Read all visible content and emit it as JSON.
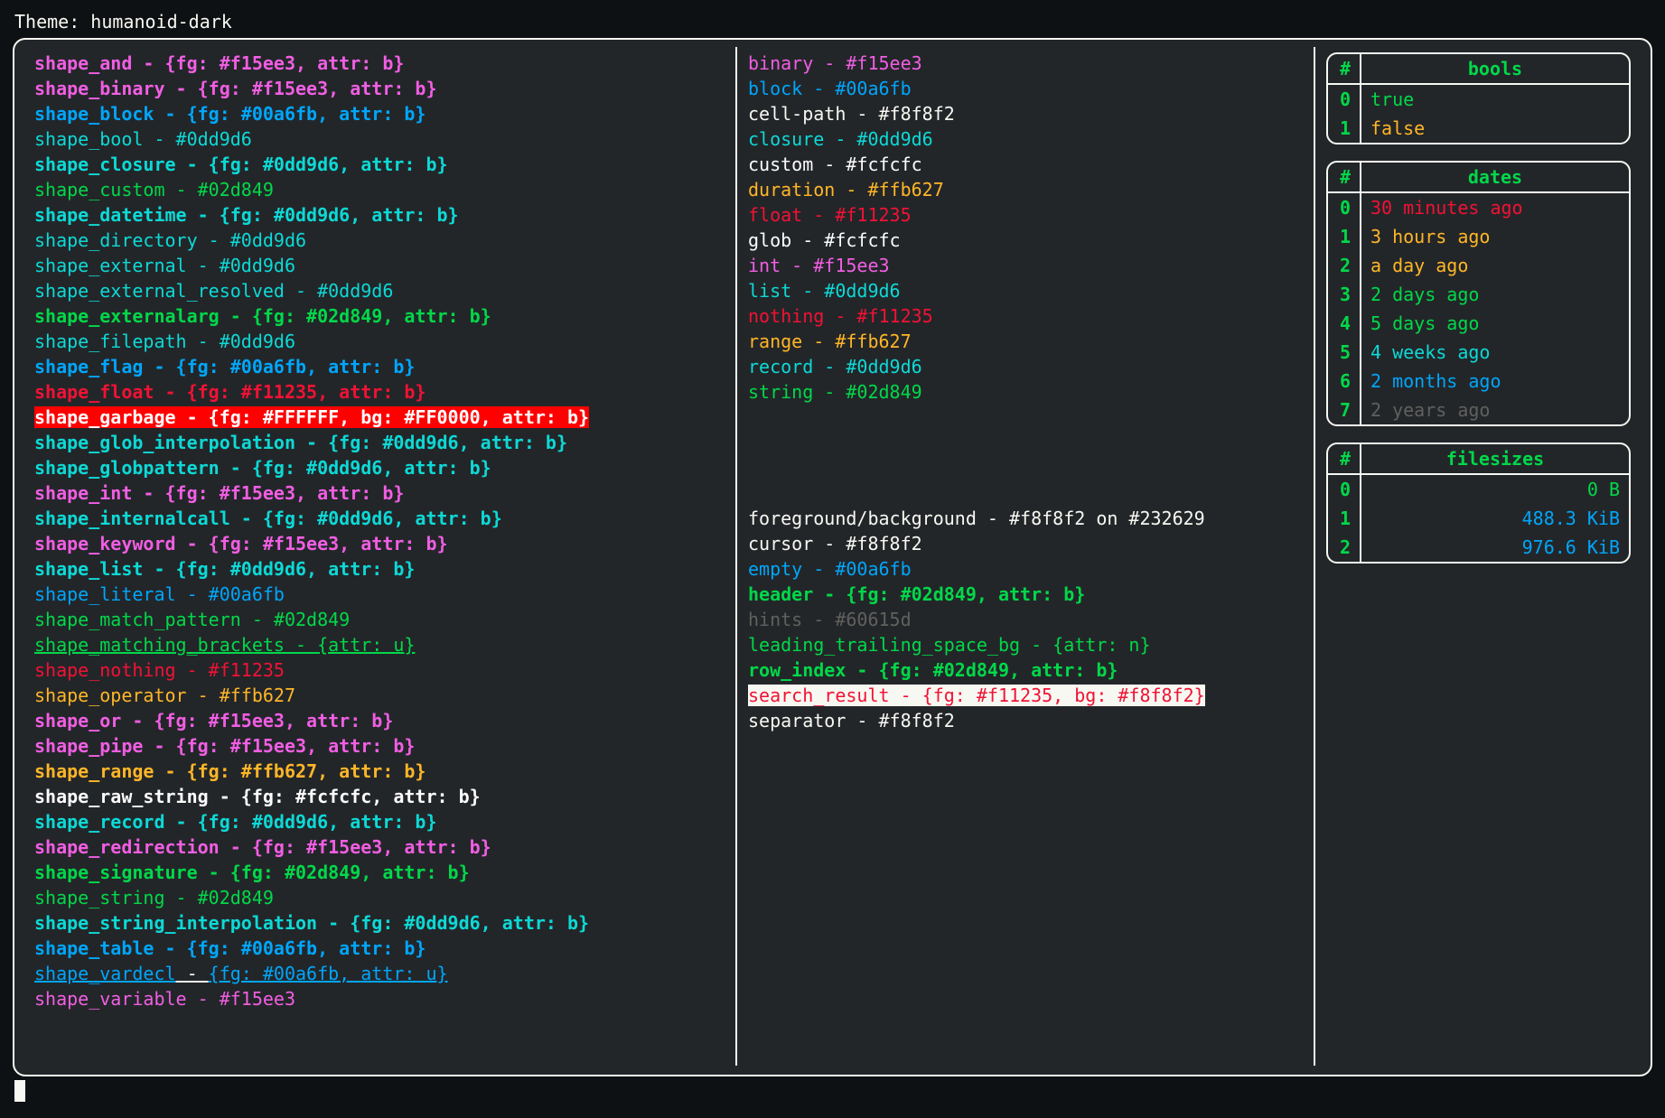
{
  "title": "Theme: humanoid-dark",
  "palette": {
    "magenta": "#f15ee3",
    "blue": "#00a6fb",
    "cyan": "#0dd9d6",
    "green": "#02d849",
    "yellow": "#ffb627",
    "red": "#f11235",
    "white": "#fcfcfc",
    "fg": "#f8f8f2",
    "bg": "#232629",
    "hint": "#60615d",
    "garbage_fg": "#FFFFFF",
    "garbage_bg": "#FF0000"
  },
  "shapes": [
    {
      "name": "shape_and",
      "style": "fgb",
      "color": "magenta"
    },
    {
      "name": "shape_binary",
      "style": "fgb",
      "color": "magenta"
    },
    {
      "name": "shape_block",
      "style": "fgb",
      "color": "blue"
    },
    {
      "name": "shape_bool",
      "style": "fg",
      "color": "cyan"
    },
    {
      "name": "shape_closure",
      "style": "fgb",
      "color": "cyan"
    },
    {
      "name": "shape_custom",
      "style": "fg",
      "color": "green"
    },
    {
      "name": "shape_datetime",
      "style": "fgb",
      "color": "cyan"
    },
    {
      "name": "shape_directory",
      "style": "fg",
      "color": "cyan"
    },
    {
      "name": "shape_external",
      "style": "fg",
      "color": "cyan"
    },
    {
      "name": "shape_external_resolved",
      "style": "fg",
      "color": "cyan"
    },
    {
      "name": "shape_externalarg",
      "style": "fgb",
      "color": "green"
    },
    {
      "name": "shape_filepath",
      "style": "fg",
      "color": "cyan"
    },
    {
      "name": "shape_flag",
      "style": "fgb",
      "color": "blue"
    },
    {
      "name": "shape_float",
      "style": "fgb",
      "color": "red"
    },
    {
      "name": "shape_garbage",
      "style": "garbage"
    },
    {
      "name": "shape_glob_interpolation",
      "style": "fgb",
      "color": "cyan"
    },
    {
      "name": "shape_globpattern",
      "style": "fgb",
      "color": "cyan"
    },
    {
      "name": "shape_int",
      "style": "fgb",
      "color": "magenta"
    },
    {
      "name": "shape_internalcall",
      "style": "fgb",
      "color": "cyan"
    },
    {
      "name": "shape_keyword",
      "style": "fgb",
      "color": "magenta"
    },
    {
      "name": "shape_list",
      "style": "fgb",
      "color": "cyan"
    },
    {
      "name": "shape_literal",
      "style": "fg",
      "color": "blue"
    },
    {
      "name": "shape_match_pattern",
      "style": "fg",
      "color": "green"
    },
    {
      "name": "shape_matching_brackets",
      "style": "attr_u",
      "color": "green"
    },
    {
      "name": "shape_nothing",
      "style": "fg",
      "color": "red"
    },
    {
      "name": "shape_operator",
      "style": "fg",
      "color": "yellow"
    },
    {
      "name": "shape_or",
      "style": "fgb",
      "color": "magenta"
    },
    {
      "name": "shape_pipe",
      "style": "fgb",
      "color": "magenta"
    },
    {
      "name": "shape_range",
      "style": "fgb",
      "color": "yellow"
    },
    {
      "name": "shape_raw_string",
      "style": "fgb",
      "color": "white"
    },
    {
      "name": "shape_record",
      "style": "fgb",
      "color": "cyan"
    },
    {
      "name": "shape_redirection",
      "style": "fgb",
      "color": "magenta"
    },
    {
      "name": "shape_signature",
      "style": "fgb",
      "color": "green"
    },
    {
      "name": "shape_string",
      "style": "fg",
      "color": "green"
    },
    {
      "name": "shape_string_interpolation",
      "style": "fgb",
      "color": "cyan"
    },
    {
      "name": "shape_table",
      "style": "fgb",
      "color": "blue"
    },
    {
      "name": "shape_vardecl",
      "style": "vardecl",
      "color": "blue"
    },
    {
      "name": "shape_variable",
      "style": "fg",
      "color": "magenta"
    }
  ],
  "types": [
    {
      "name": "binary",
      "color": "magenta"
    },
    {
      "name": "block",
      "color": "blue"
    },
    {
      "name": "cell-path",
      "color": "fg"
    },
    {
      "name": "closure",
      "color": "cyan"
    },
    {
      "name": "custom",
      "color": "white"
    },
    {
      "name": "duration",
      "color": "yellow"
    },
    {
      "name": "float",
      "color": "red"
    },
    {
      "name": "glob",
      "color": "white"
    },
    {
      "name": "int",
      "color": "magenta"
    },
    {
      "name": "list",
      "color": "cyan"
    },
    {
      "name": "nothing",
      "color": "red"
    },
    {
      "name": "range",
      "color": "yellow"
    },
    {
      "name": "record",
      "color": "cyan"
    },
    {
      "name": "string",
      "color": "green"
    }
  ],
  "misc": [
    {
      "kind": "plain",
      "name": "foreground/background",
      "text": "#f8f8f2 on #232629",
      "color": "fg"
    },
    {
      "kind": "plain",
      "name": "cursor",
      "text": "#f8f8f2",
      "color": "fg"
    },
    {
      "kind": "plain",
      "name": "empty",
      "text": "#00a6fb",
      "color": "blue"
    },
    {
      "kind": "fgb",
      "name": "header",
      "color": "green"
    },
    {
      "kind": "plain",
      "name": "hints",
      "text": "#60615d",
      "color": "hint"
    },
    {
      "kind": "attr",
      "name": "leading_trailing_space_bg",
      "attr": "n",
      "color": "green"
    },
    {
      "kind": "fgb",
      "name": "row_index",
      "color": "green"
    },
    {
      "kind": "search",
      "name": "search_result"
    },
    {
      "kind": "plain",
      "name": "separator",
      "text": "#f8f8f2",
      "color": "fg"
    }
  ],
  "tables": {
    "bools": {
      "header": [
        "#",
        "bools"
      ],
      "rows": [
        {
          "i": "0",
          "v": "true",
          "c": "green"
        },
        {
          "i": "1",
          "v": "false",
          "c": "yellow"
        }
      ]
    },
    "dates": {
      "header": [
        "#",
        "dates"
      ],
      "rows": [
        {
          "i": "0",
          "v": "30 minutes ago",
          "c": "red"
        },
        {
          "i": "1",
          "v": "3 hours ago",
          "c": "yellow"
        },
        {
          "i": "2",
          "v": "a day ago",
          "c": "yellow"
        },
        {
          "i": "3",
          "v": "2 days ago",
          "c": "green"
        },
        {
          "i": "4",
          "v": "5 days ago",
          "c": "green"
        },
        {
          "i": "5",
          "v": "4 weeks ago",
          "c": "cyan"
        },
        {
          "i": "6",
          "v": "2 months ago",
          "c": "blue"
        },
        {
          "i": "7",
          "v": "2 years ago",
          "c": "hint"
        }
      ]
    },
    "filesizes": {
      "header": [
        "#",
        "filesizes"
      ],
      "right_align": true,
      "rows": [
        {
          "i": "0",
          "v": "0 B",
          "c": "green"
        },
        {
          "i": "1",
          "v": "488.3 KiB",
          "c": "blue"
        },
        {
          "i": "2",
          "v": "976.6 KiB",
          "c": "blue"
        }
      ]
    }
  }
}
